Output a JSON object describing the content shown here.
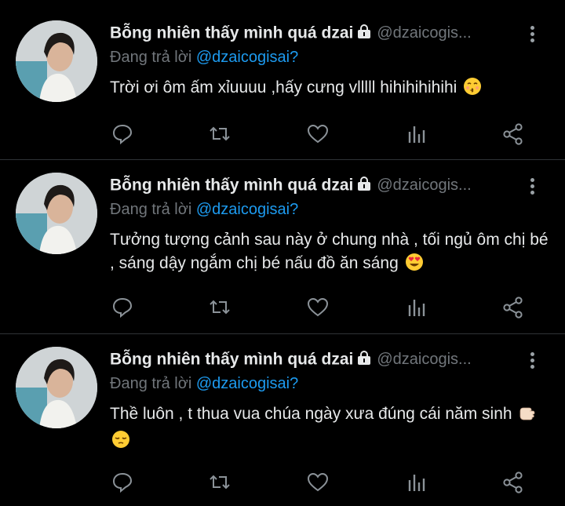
{
  "tweets": [
    {
      "name": "Bỗng nhiên thấy mình quá dzai",
      "handle": "@dzaicogis...",
      "reply_prefix": "Đang trả lời",
      "reply_to": "@dzaicogisai?",
      "text": "Trời ơi ôm ấm xỉuuuu ,hấy cưng vlllll hihihihihihi",
      "emoji": "kissing-face"
    },
    {
      "name": "Bỗng nhiên thấy mình quá dzai",
      "handle": "@dzaicogis...",
      "reply_prefix": "Đang trả lời",
      "reply_to": "@dzaicogisai?",
      "text": "Tưởng tượng cảnh sau này ở chung nhà , tối ngủ ôm chị bé , sáng dậy ngắm chị bé nấu đồ ăn sáng",
      "emoji": "heart-eyes-face"
    },
    {
      "name": "Bỗng nhiên thấy mình quá dzai",
      "handle": "@dzaicogis...",
      "reply_prefix": "Đang trả lời",
      "reply_to": "@dzaicogisai?",
      "text": "Thề luôn , t thua vua chúa ngày xưa đúng cái năm sinh",
      "emoji": "pointing-hand-and-pensive-face"
    }
  ],
  "colors": {
    "background": "#000000",
    "text": "#e7e9ea",
    "muted": "#71767b",
    "mention": "#1d9bf0",
    "divider": "#2f3336"
  },
  "icons": [
    "lock-icon",
    "more-vertical-icon",
    "reply-icon",
    "retweet-icon",
    "like-icon",
    "views-icon",
    "share-icon"
  ]
}
